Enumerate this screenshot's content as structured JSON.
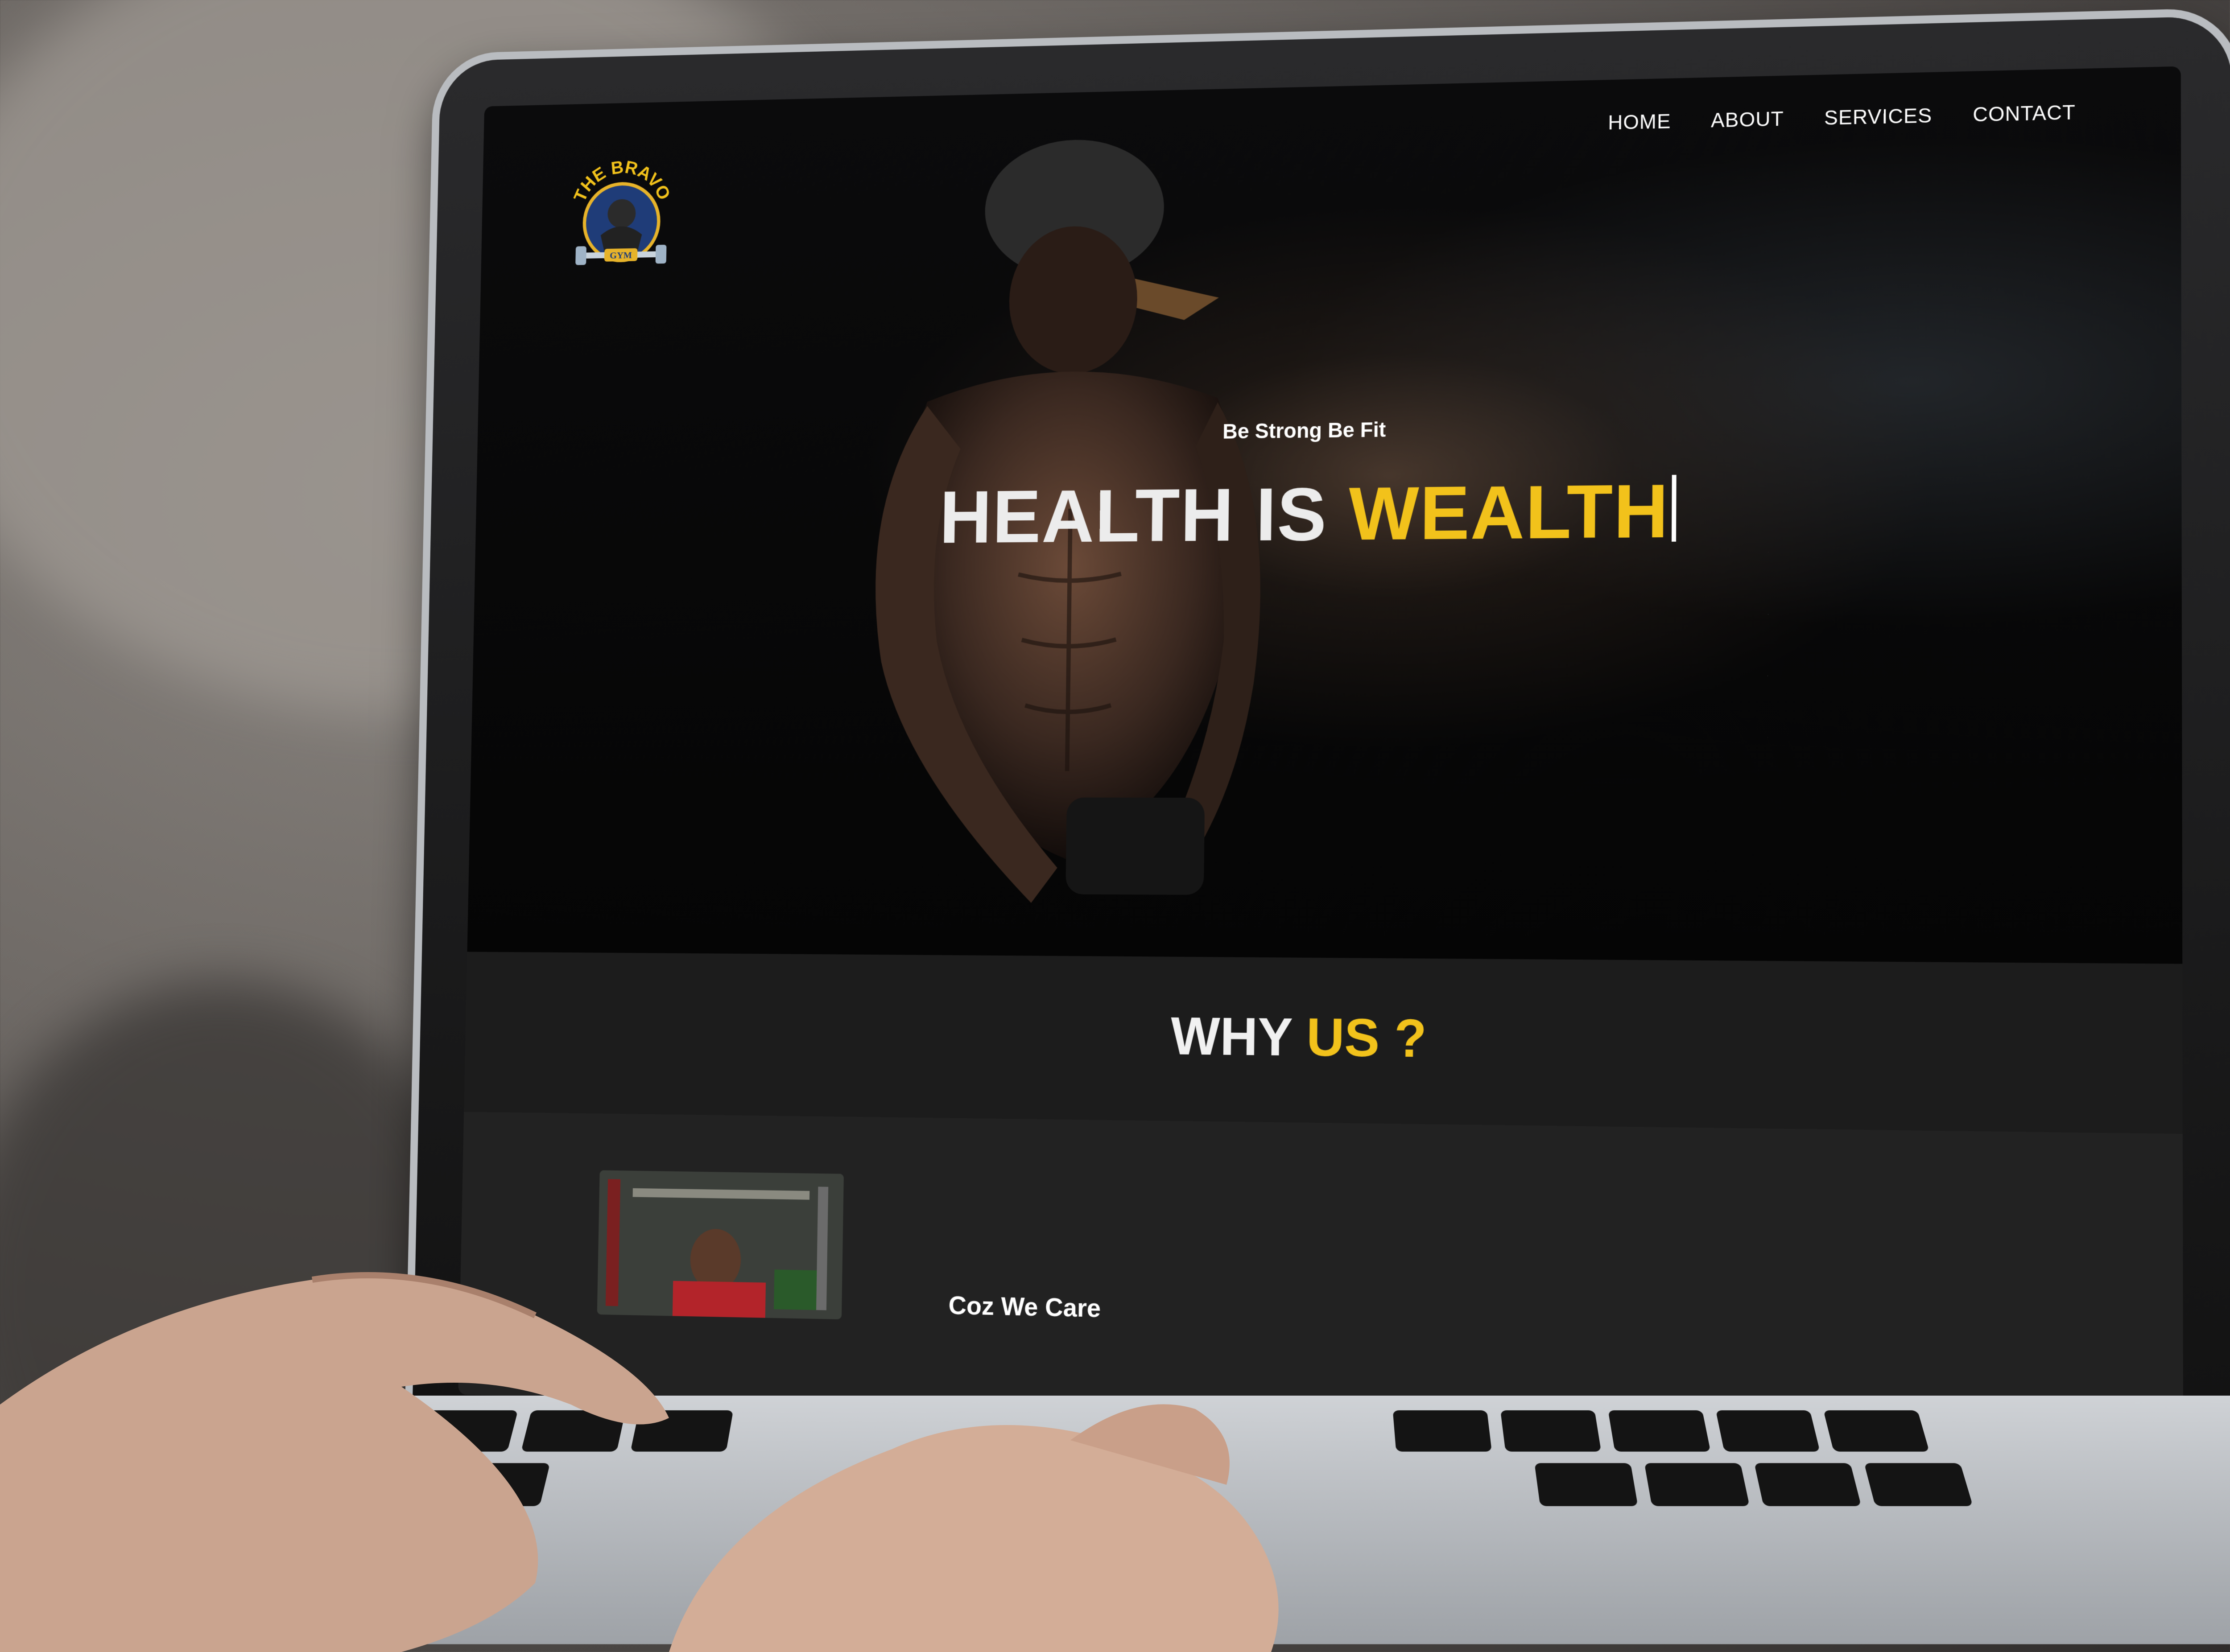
{
  "site": {
    "logo": {
      "arc_text": "THE BRAVO",
      "badge_text": "GYM",
      "icon": "muscle-man-dumbbell-logo"
    },
    "nav": [
      {
        "label": "HOME"
      },
      {
        "label": "ABOUT"
      },
      {
        "label": "SERVICES"
      },
      {
        "label": "CONTACT"
      }
    ],
    "hero": {
      "tagline": "Be Strong Be Fit",
      "headline_white": "HEALTH IS ",
      "headline_accent": "WEALTH"
    },
    "why": {
      "title_white": "WHY ",
      "title_accent": "US ?",
      "caption": "Coz We Care"
    }
  },
  "colors": {
    "accent": "#f2c21b",
    "background": "#1c1c1c",
    "text": "#ffffff"
  }
}
